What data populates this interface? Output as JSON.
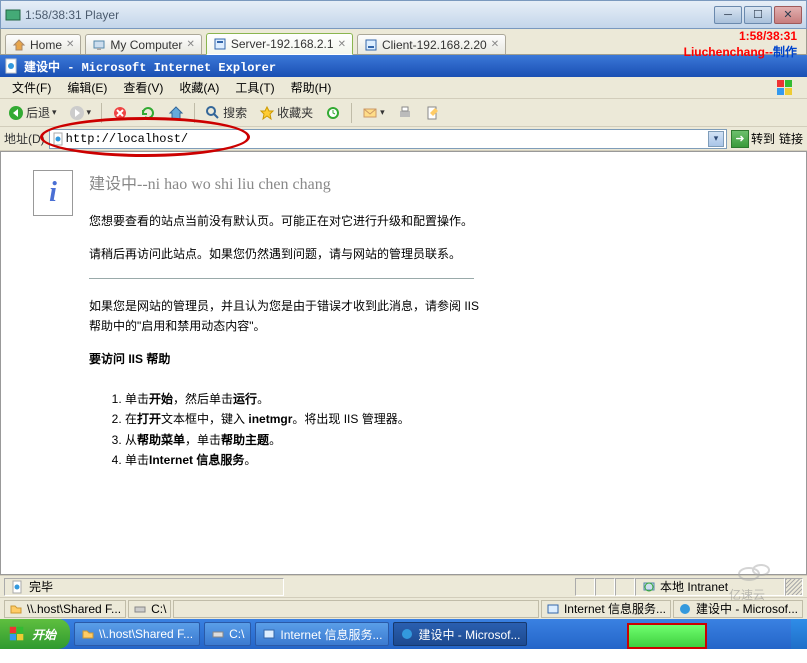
{
  "outer_window": {
    "title": "1:58/38:31 Player"
  },
  "overlay": {
    "time": "1:58/38:31",
    "author": "Liuchenchang--",
    "make": "制作"
  },
  "tabs": [
    {
      "icon": "home-icon",
      "label": "Home"
    },
    {
      "icon": "computer-icon",
      "label": "My Computer"
    },
    {
      "icon": "server-icon",
      "label": "Server-192.168.2.1"
    },
    {
      "icon": "client-icon",
      "label": "Client-192.168.2.20"
    }
  ],
  "ie_title": "建设中 - Microsoft Internet Explorer",
  "menu": {
    "file": "文件(F)",
    "edit": "编辑(E)",
    "view": "查看(V)",
    "favorites": "收藏(A)",
    "tools": "工具(T)",
    "help": "帮助(H)"
  },
  "toolbar": {
    "back": "后退",
    "search": "搜索",
    "favorites": "收藏夹"
  },
  "address": {
    "label": "地址(D)",
    "url": "http://localhost/",
    "go": "转到",
    "links": "链接"
  },
  "page": {
    "heading": "建设中--ni hao wo shi liu chen chang",
    "p1": "您想要查看的站点当前没有默认页。可能正在对它进行升级和配置操作。",
    "p2": "请稍后再访问此站点。如果您仍然遇到问题，请与网站的管理员联系。",
    "p3a": "如果您是网站的管理员，并且认为您是由于错误才收到此消息，请参阅 IIS",
    "p3b": "帮助中的\"启用和禁用动态内容\"。",
    "p4": "要访问 IIS 帮助",
    "li1a": "单击",
    "li1b": "开始",
    "li1c": "，然后单击",
    "li1d": "运行",
    "li1e": "。",
    "li2a": "在",
    "li2b": "打开",
    "li2c": "文本框中，键入 ",
    "li2d": "inetmgr",
    "li2e": "。将出现 IIS 管理器。",
    "li3a": "从",
    "li3b": "帮助菜单",
    "li3c": "，单击",
    "li3d": "帮助主题",
    "li3e": "。",
    "li4a": "单击",
    "li4b": "Internet 信息服务",
    "li4c": "。"
  },
  "ie_status": {
    "msg": "完毕",
    "zone": "本地 Intranet"
  },
  "outer_status": {
    "items": [
      {
        "icon": "folder-icon",
        "label": "\\\\.host\\Shared F..."
      },
      {
        "icon": "drive-icon",
        "label": "C:\\"
      },
      {
        "icon": "iis-icon",
        "label": "Internet 信息服务..."
      },
      {
        "icon": "ie-icon",
        "label": "建设中 - Microsof..."
      }
    ]
  },
  "taskbar": {
    "start": "开始",
    "items": [
      {
        "icon": "folder-icon",
        "label": "\\\\.host\\Shared F..."
      },
      {
        "icon": "drive-icon",
        "label": "C:\\"
      },
      {
        "icon": "iis-icon",
        "label": "Internet 信息服务..."
      },
      {
        "icon": "ie-icon",
        "label": "建设中 - Microsof..."
      }
    ]
  },
  "watermark": "亿速云"
}
